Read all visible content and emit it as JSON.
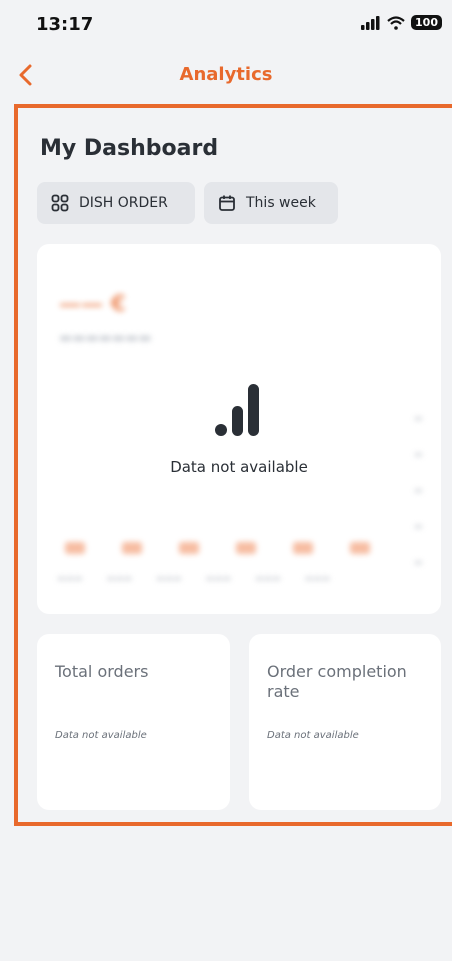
{
  "status_bar": {
    "time": "13:17",
    "battery": "100"
  },
  "header": {
    "title": "Analytics",
    "back_icon": "chevron-left-icon"
  },
  "dashboard": {
    "title": "My Dashboard",
    "filters": [
      {
        "label": "DISH ORDER",
        "icon": "grid-icon"
      },
      {
        "label": "This week",
        "icon": "calendar-icon"
      }
    ],
    "turnover_card": {
      "empty_message": "Data not available",
      "empty_icon": "bar-chart-icon"
    },
    "metrics": [
      {
        "title": "Total orders",
        "value": "Data not available"
      },
      {
        "title": "Order completion rate",
        "value": "Data not available"
      }
    ]
  },
  "colors": {
    "accent": "#e8692c",
    "background": "#f2f3f5",
    "card": "#ffffff",
    "chip": "#e4e6ea"
  }
}
